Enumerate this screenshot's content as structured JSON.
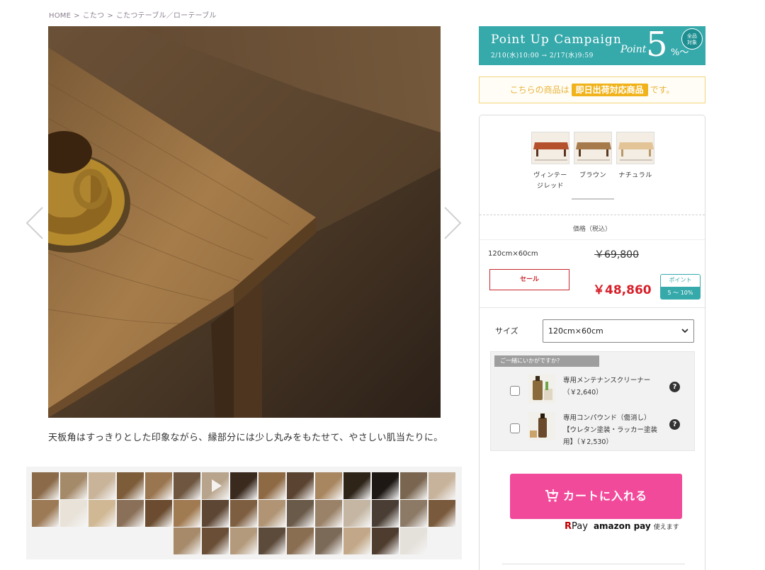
{
  "breadcrumb": [
    "HOME",
    "こたつ",
    "こたつテーブル／ローテーブル"
  ],
  "breadcrumb_sep": ">",
  "gallery": {
    "caption": "天板角はすっきりとした印象ながら、縁部分には少し丸みをもたせて、やさしい肌当たりに。",
    "thumb_count": 39
  },
  "campaign": {
    "title": "Point Up Campaign",
    "dates": "2/10(水)10:00 → 2/17(水)9:59",
    "point_word": "Point",
    "value": "5",
    "suffix": "%〜",
    "badge_line1": "全品",
    "badge_line2": "対象"
  },
  "sameday": {
    "prefix": "こちらの商品は",
    "tag": "即日出荷対応商品",
    "suffix": "です。"
  },
  "colors": [
    {
      "label1": "ヴィンテー",
      "label2": "ジレッド",
      "color": "#b5502c"
    },
    {
      "label1": "ブラウン",
      "label2": "",
      "color": "#a77a4b"
    },
    {
      "label1": "ナチュラル",
      "label2": "",
      "color": "#e3c497"
    }
  ],
  "price": {
    "heading": "価格（税込）",
    "size": "120cm×60cm",
    "old_price": "￥69,800",
    "sale_label": "セール",
    "sale_price": "￥48,860",
    "point_label": "ポイント",
    "point_range": "5 〜 10%"
  },
  "size_select": {
    "label": "サイズ",
    "value": "120cm×60cm"
  },
  "recommend": {
    "heading": "ご一緒にいかがですか？",
    "items": [
      {
        "line1": "専用メンテナンスクリーナー",
        "line2": "（￥2,640）",
        "line3": ""
      },
      {
        "line1": "専用コンパウンド（傷消し）",
        "line2": "【ウレタン塗装・ラッカー塗装",
        "line3": "用】（￥2,530）"
      }
    ]
  },
  "cart": {
    "label": "カートに入れる"
  },
  "payment": {
    "rpay_r": "R",
    "rpay": "Pay",
    "amazon": "amazon pay",
    "note": "使えます"
  }
}
